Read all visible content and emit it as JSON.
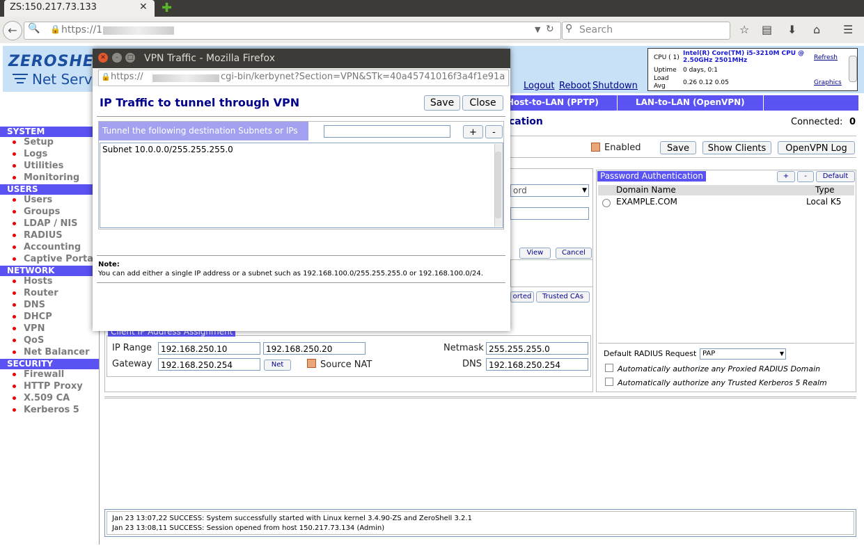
{
  "browser": {
    "tab_title": "ZS:150.217.73.133",
    "url": "https://1",
    "search_placeholder": "Search"
  },
  "app": {
    "logo_top": "ZEROSHEL",
    "logo_bottom": "Net Servi",
    "cpu": {
      "cpu_label": "CPU ( 1)",
      "cpu_value": "Intel(R) Core(TM) i5-3210M CPU @ 2.50GHz 2501MHz",
      "uptime_label": "Uptime",
      "uptime_value": "0 days, 0:1",
      "load_label": "Load Avg",
      "load_value": "0.26 0.12 0.05",
      "refresh": "Refresh",
      "graphics": "Graphics"
    },
    "top_links": {
      "logout": "Logout",
      "reboot": "Reboot",
      "shutdown": "Shutdown"
    },
    "vpn_tabs": [
      "Host-to-LAN  (PPTP)",
      "LAN-to-LAN (OpenVPN)"
    ],
    "section_heading": "cation",
    "connected_label": "Connected:",
    "connected_value": "0",
    "enabled_label": "Enabled",
    "buttons": {
      "save": "Save",
      "show_clients": "Show Clients",
      "openvpn_log": "OpenVPN Log"
    },
    "sidebar": [
      {
        "section": "SYSTEM",
        "items": [
          "Setup",
          "Logs",
          "Utilities",
          "Monitoring"
        ]
      },
      {
        "section": "USERS",
        "items": [
          "Users",
          "Groups",
          "LDAP / NIS",
          "RADIUS",
          "Accounting",
          "Captive Portal"
        ]
      },
      {
        "section": "NETWORK",
        "items": [
          "Hosts",
          "Router",
          "DNS",
          "DHCP",
          "VPN",
          "QoS",
          "Net Balancer"
        ]
      },
      {
        "section": "SECURITY",
        "items": [
          "Firewall",
          "HTTP Proxy",
          "X.509 CA",
          "Kerberos 5"
        ]
      }
    ],
    "auth_select_partial": "ord",
    "view_button": "View",
    "cancel_button": "Cancel",
    "imported_partial": "orted",
    "trusted_cas": "Trusted CAs",
    "client_ip": {
      "legend": "Client IP Address Assignment",
      "ip_range_label": "IP Range",
      "ip_from": "192.168.250.10",
      "ip_to": "192.168.250.20",
      "netmask_label": "Netmask",
      "netmask": "255.255.255.0",
      "gateway_label": "Gateway",
      "gateway": "192.168.250.254",
      "net_button": "Net",
      "source_nat_label": "Source NAT",
      "dns_label": "DNS",
      "dns": "192.168.250.254"
    },
    "password_auth": {
      "title": "Password Authentication",
      "plus": "+",
      "minus": "-",
      "default": "Default",
      "col_domain": "Domain Name",
      "col_type": "Type",
      "rows": [
        {
          "domain": "EXAMPLE.COM",
          "type": "Local K5"
        }
      ],
      "default_radius_label": "Default RADIUS Request",
      "default_radius_value": "PAP",
      "auto_proxied": "Automatically authorize any Proxied RADIUS Domain",
      "auto_kerberos": "Automatically authorize any Trusted Kerberos 5 Realm"
    },
    "log_lines": [
      "Jan 23 13:07,22 SUCCESS: System successfully started with Linux kernel 3.4.90-ZS and ZeroShell 3.2.1",
      "Jan 23 13:08,11 SUCCESS: Session opened from host 150.217.73.134 (Admin)"
    ]
  },
  "dialog": {
    "window_title": "VPN Traffic - Mozilla Firefox",
    "url_prefix": "https://",
    "url_suffix": "cgi-bin/kerbynet?Section=VPN&STk=40a45741016f3a4f1e91a",
    "heading": "IP Traffic to tunnel through VPN",
    "save": "Save",
    "close": "Close",
    "subnets_label": "Tunnel the following destination Subnets or IPs",
    "plus": "+",
    "minus": "-",
    "entries": [
      "Subnet 10.0.0.0/255.255.255.0"
    ],
    "note_title": "Note:",
    "note_text": "You can add either a single IP address or a subnet such as 192.168.100.0/255.255.255.0 or 192.168.100.0/24."
  }
}
